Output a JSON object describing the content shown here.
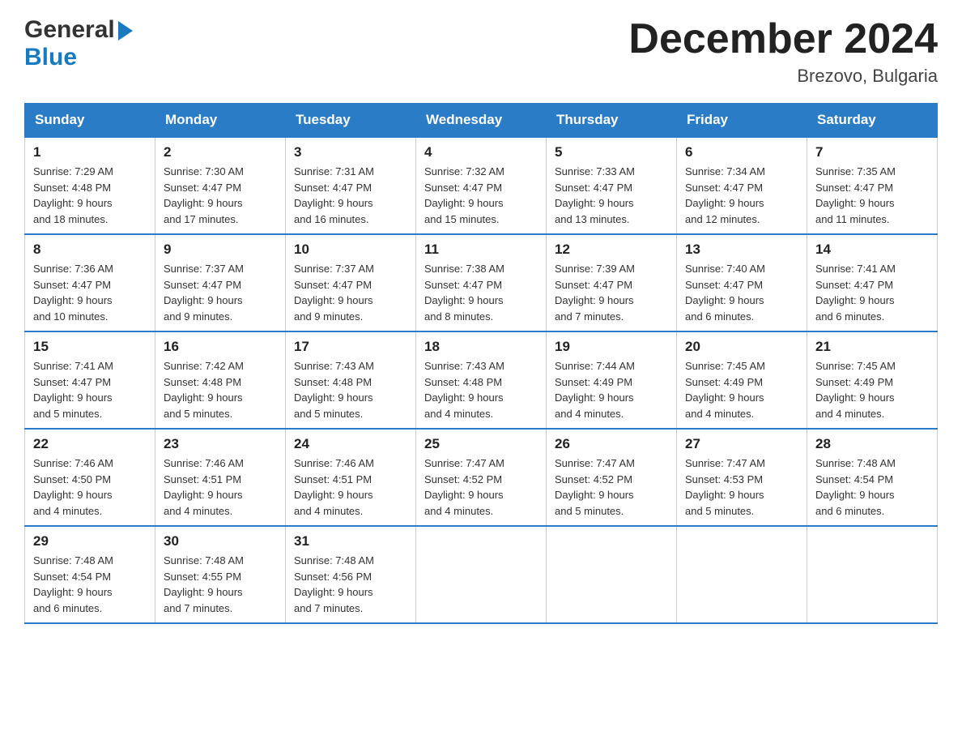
{
  "header": {
    "logo_general": "General",
    "logo_blue": "Blue",
    "month_title": "December 2024",
    "location": "Brezovo, Bulgaria"
  },
  "days_of_week": [
    "Sunday",
    "Monday",
    "Tuesday",
    "Wednesday",
    "Thursday",
    "Friday",
    "Saturday"
  ],
  "weeks": [
    [
      {
        "num": "1",
        "sunrise": "7:29 AM",
        "sunset": "4:48 PM",
        "daylight": "9 hours and 18 minutes."
      },
      {
        "num": "2",
        "sunrise": "7:30 AM",
        "sunset": "4:47 PM",
        "daylight": "9 hours and 17 minutes."
      },
      {
        "num": "3",
        "sunrise": "7:31 AM",
        "sunset": "4:47 PM",
        "daylight": "9 hours and 16 minutes."
      },
      {
        "num": "4",
        "sunrise": "7:32 AM",
        "sunset": "4:47 PM",
        "daylight": "9 hours and 15 minutes."
      },
      {
        "num": "5",
        "sunrise": "7:33 AM",
        "sunset": "4:47 PM",
        "daylight": "9 hours and 13 minutes."
      },
      {
        "num": "6",
        "sunrise": "7:34 AM",
        "sunset": "4:47 PM",
        "daylight": "9 hours and 12 minutes."
      },
      {
        "num": "7",
        "sunrise": "7:35 AM",
        "sunset": "4:47 PM",
        "daylight": "9 hours and 11 minutes."
      }
    ],
    [
      {
        "num": "8",
        "sunrise": "7:36 AM",
        "sunset": "4:47 PM",
        "daylight": "9 hours and 10 minutes."
      },
      {
        "num": "9",
        "sunrise": "7:37 AM",
        "sunset": "4:47 PM",
        "daylight": "9 hours and 9 minutes."
      },
      {
        "num": "10",
        "sunrise": "7:37 AM",
        "sunset": "4:47 PM",
        "daylight": "9 hours and 9 minutes."
      },
      {
        "num": "11",
        "sunrise": "7:38 AM",
        "sunset": "4:47 PM",
        "daylight": "9 hours and 8 minutes."
      },
      {
        "num": "12",
        "sunrise": "7:39 AM",
        "sunset": "4:47 PM",
        "daylight": "9 hours and 7 minutes."
      },
      {
        "num": "13",
        "sunrise": "7:40 AM",
        "sunset": "4:47 PM",
        "daylight": "9 hours and 6 minutes."
      },
      {
        "num": "14",
        "sunrise": "7:41 AM",
        "sunset": "4:47 PM",
        "daylight": "9 hours and 6 minutes."
      }
    ],
    [
      {
        "num": "15",
        "sunrise": "7:41 AM",
        "sunset": "4:47 PM",
        "daylight": "9 hours and 5 minutes."
      },
      {
        "num": "16",
        "sunrise": "7:42 AM",
        "sunset": "4:48 PM",
        "daylight": "9 hours and 5 minutes."
      },
      {
        "num": "17",
        "sunrise": "7:43 AM",
        "sunset": "4:48 PM",
        "daylight": "9 hours and 5 minutes."
      },
      {
        "num": "18",
        "sunrise": "7:43 AM",
        "sunset": "4:48 PM",
        "daylight": "9 hours and 4 minutes."
      },
      {
        "num": "19",
        "sunrise": "7:44 AM",
        "sunset": "4:49 PM",
        "daylight": "9 hours and 4 minutes."
      },
      {
        "num": "20",
        "sunrise": "7:45 AM",
        "sunset": "4:49 PM",
        "daylight": "9 hours and 4 minutes."
      },
      {
        "num": "21",
        "sunrise": "7:45 AM",
        "sunset": "4:49 PM",
        "daylight": "9 hours and 4 minutes."
      }
    ],
    [
      {
        "num": "22",
        "sunrise": "7:46 AM",
        "sunset": "4:50 PM",
        "daylight": "9 hours and 4 minutes."
      },
      {
        "num": "23",
        "sunrise": "7:46 AM",
        "sunset": "4:51 PM",
        "daylight": "9 hours and 4 minutes."
      },
      {
        "num": "24",
        "sunrise": "7:46 AM",
        "sunset": "4:51 PM",
        "daylight": "9 hours and 4 minutes."
      },
      {
        "num": "25",
        "sunrise": "7:47 AM",
        "sunset": "4:52 PM",
        "daylight": "9 hours and 4 minutes."
      },
      {
        "num": "26",
        "sunrise": "7:47 AM",
        "sunset": "4:52 PM",
        "daylight": "9 hours and 5 minutes."
      },
      {
        "num": "27",
        "sunrise": "7:47 AM",
        "sunset": "4:53 PM",
        "daylight": "9 hours and 5 minutes."
      },
      {
        "num": "28",
        "sunrise": "7:48 AM",
        "sunset": "4:54 PM",
        "daylight": "9 hours and 6 minutes."
      }
    ],
    [
      {
        "num": "29",
        "sunrise": "7:48 AM",
        "sunset": "4:54 PM",
        "daylight": "9 hours and 6 minutes."
      },
      {
        "num": "30",
        "sunrise": "7:48 AM",
        "sunset": "4:55 PM",
        "daylight": "9 hours and 7 minutes."
      },
      {
        "num": "31",
        "sunrise": "7:48 AM",
        "sunset": "4:56 PM",
        "daylight": "9 hours and 7 minutes."
      },
      null,
      null,
      null,
      null
    ]
  ],
  "labels": {
    "sunrise": "Sunrise:",
    "sunset": "Sunset:",
    "daylight": "Daylight:"
  }
}
